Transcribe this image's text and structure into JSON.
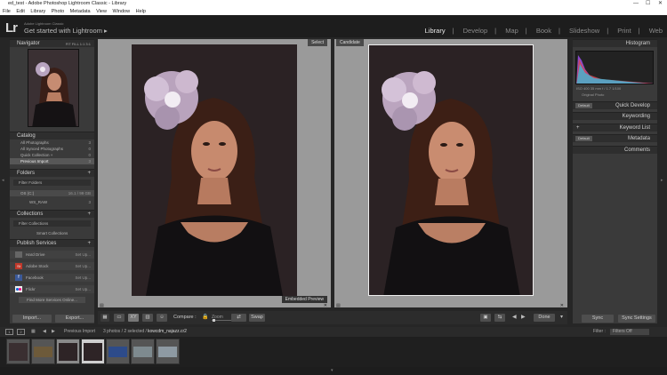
{
  "window": {
    "title": "ed_test - Adobe Photoshop Lightroom Classic - Library"
  },
  "menu": [
    "File",
    "Edit",
    "Library",
    "Photo",
    "Metadata",
    "View",
    "Window",
    "Help"
  ],
  "identity": {
    "small": "Adobe Lightroom Classic",
    "main": "Get started with Lightroom ▸",
    "logo": "Lr"
  },
  "modules": [
    "Library",
    "Develop",
    "Map",
    "Book",
    "Slideshow",
    "Print",
    "Web"
  ],
  "active_module": "Library",
  "left": {
    "navigator": {
      "title": "Navigator",
      "zoom": "FIT   FILL   1:1   3:1"
    },
    "catalog": {
      "title": "Catalog",
      "items": [
        {
          "label": "All Photographs",
          "count": "3"
        },
        {
          "label": "All Synced Photographs",
          "count": "0"
        },
        {
          "label": "Quick Collection +",
          "count": "0"
        },
        {
          "label": "Previous Import",
          "count": "3"
        }
      ]
    },
    "folders": {
      "title": "Folders",
      "filter": "Filter Folders",
      "drive": "OS (C:)",
      "drive_info": "16.1 / 99 GB",
      "folder": "WS_RAW",
      "folder_count": "3"
    },
    "collections": {
      "title": "Collections",
      "filter": "Filter Collections",
      "item": "Smart Collections"
    },
    "publish": {
      "title": "Publish Services",
      "services": [
        {
          "label": "Hard Drive",
          "action": "Set Up..."
        },
        {
          "label": "Adobe Stock",
          "action": "Set Up..."
        },
        {
          "label": "Facebook",
          "action": "Set Up..."
        },
        {
          "label": "Flickr",
          "action": "Set Up..."
        }
      ],
      "more": "Find More Services Online..."
    },
    "import": "Import...",
    "export": "Export..."
  },
  "compare": {
    "select_tag": "Select",
    "candidate_tag": "Candidate",
    "preview": "Embedded Preview"
  },
  "toolbar": {
    "compare_label": "Compare :",
    "zoom_label": "Zoom",
    "swap": "Swap",
    "done": "Done"
  },
  "right": {
    "histogram": {
      "title": "Histogram",
      "info": "ISO 400     35 mm     f / 1.7     1/100",
      "original": "Original Photo"
    },
    "quick_develop": {
      "preset": "Default",
      "title": "Quick Develop"
    },
    "keywording": "Keywording",
    "keyword_list": "Keyword List",
    "metadata": {
      "preset": "Default",
      "title": "Metadata"
    },
    "comments": "Comments",
    "sync": "Sync",
    "sync_settings": "Sync Settings"
  },
  "filmstrip": {
    "source": "Previous Import",
    "status": "3 photos / 2 selected /",
    "file": "kowcdm_najazz.cr2",
    "filter_label": "Filter :",
    "filter_value": "Filters Off",
    "pages": [
      "1",
      "2"
    ]
  },
  "colors": {
    "accent": "#e9e9e9",
    "panel": "#3a3a3a",
    "background": "#9a9a9a"
  }
}
